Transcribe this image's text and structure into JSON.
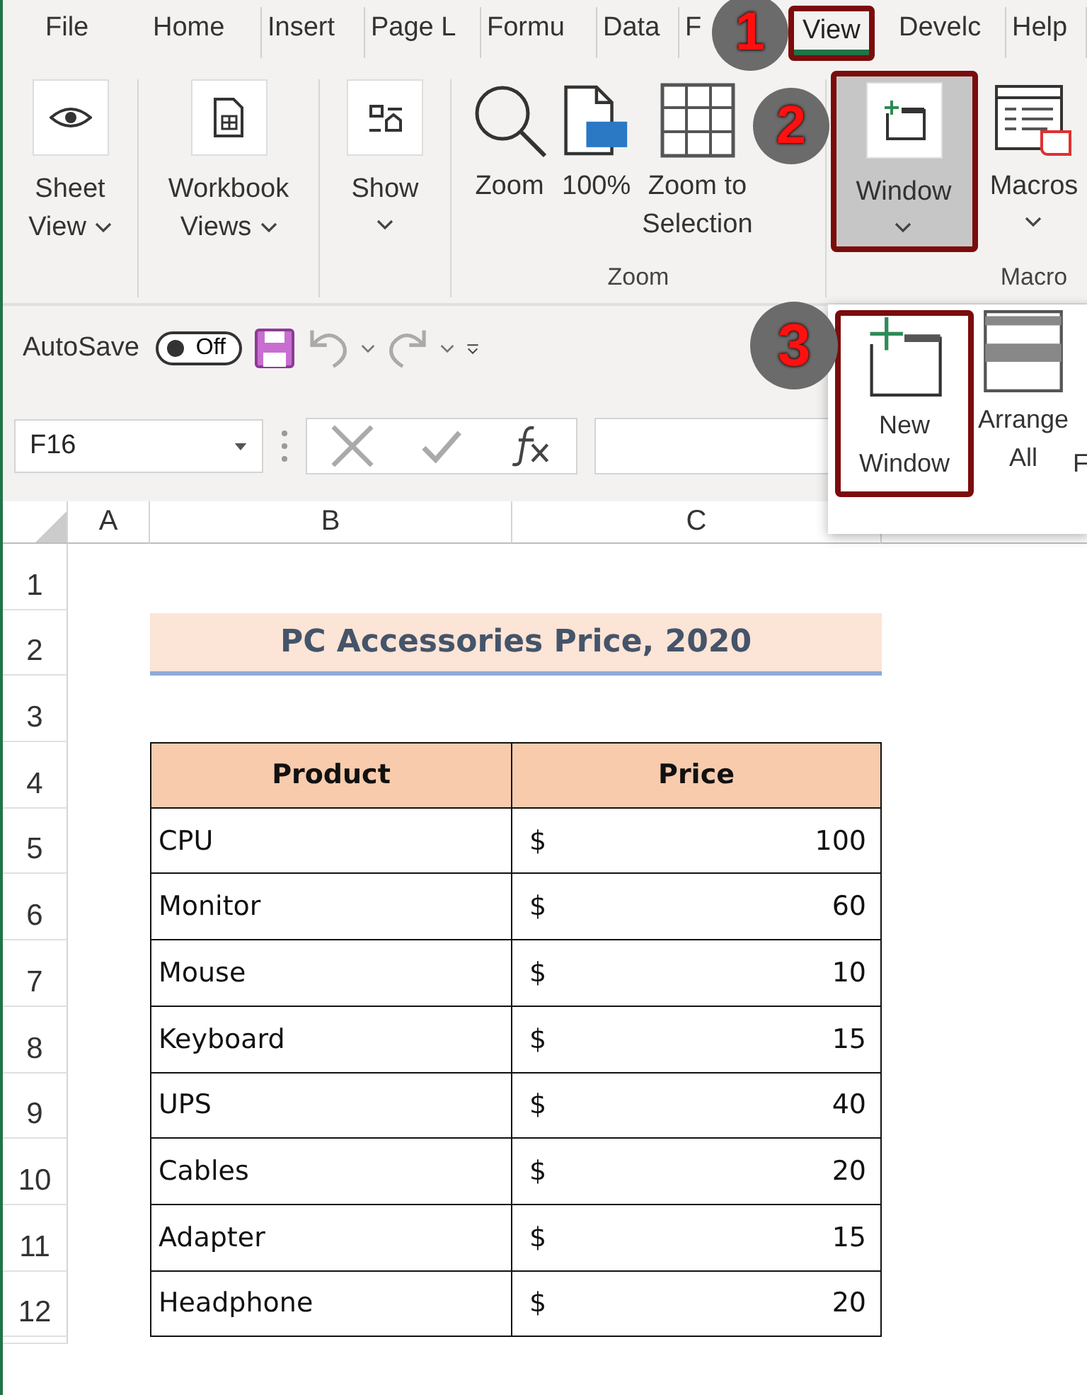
{
  "tabs": [
    {
      "label": "File",
      "selected": false,
      "highlighted": false
    },
    {
      "label": "Home",
      "selected": false,
      "highlighted": false
    },
    {
      "label": "Insert",
      "selected": false,
      "highlighted": false
    },
    {
      "label": "Page L",
      "selected": false,
      "highlighted": false
    },
    {
      "label": "Formu",
      "selected": false,
      "highlighted": false
    },
    {
      "label": "Data",
      "selected": false,
      "highlighted": false
    },
    {
      "label": "F",
      "selected": false,
      "highlighted": false
    },
    {
      "label": "View",
      "selected": true,
      "highlighted": true
    },
    {
      "label": "Develc",
      "selected": false,
      "highlighted": false
    },
    {
      "label": "Help",
      "selected": false,
      "highlighted": false
    }
  ],
  "ribbon": {
    "groups": [
      {
        "buttons": [
          {
            "kind": "eye",
            "label": "Sheet View",
            "menu": true,
            "highlighted": false
          }
        ]
      },
      {
        "buttons": [
          {
            "kind": "workbook",
            "label": "Workbook Views",
            "menu": true,
            "highlighted": false
          }
        ]
      },
      {
        "buttons": [
          {
            "kind": "show",
            "label": "Show",
            "menu": true,
            "highlighted": false
          }
        ]
      },
      {
        "label": "Zoom",
        "buttons": [
          {
            "kind": "magnifier",
            "label": "Zoom",
            "menu": false,
            "highlighted": false
          },
          {
            "kind": "hundred",
            "label": "100%",
            "menu": false,
            "highlighted": false
          },
          {
            "kind": "selection",
            "label": "Zoom to Selection",
            "menu": false,
            "highlighted": false
          }
        ]
      },
      {
        "buttons": [
          {
            "kind": "window",
            "label": "Window",
            "menu": true,
            "highlighted": true
          }
        ]
      },
      {
        "label": "Macro",
        "buttons": [
          {
            "kind": "macros",
            "label": "Macros",
            "menu": true,
            "highlighted": false
          }
        ]
      }
    ]
  },
  "quick_access": {
    "autosave_label": "AutoSave",
    "toggle": {
      "text": "Off",
      "on": false
    }
  },
  "dropdown": {
    "items": [
      {
        "kind": "newwindow",
        "label": "New Window",
        "highlighted": true
      },
      {
        "kind": "arrange",
        "label": "Arrange All",
        "highlighted": false
      },
      {
        "kind": "plain",
        "label": "F",
        "highlighted": false
      }
    ]
  },
  "formula_bar": {
    "name_box": "F16"
  },
  "callouts": [
    {
      "number": "1"
    },
    {
      "number": "2"
    },
    {
      "number": "3"
    }
  ],
  "sheet": {
    "columns": [
      "A",
      "B",
      "C"
    ],
    "row_numbers": [
      "1",
      "2",
      "3",
      "4",
      "5",
      "6",
      "7",
      "8",
      "9",
      "10",
      "11",
      "12"
    ],
    "title": "PC Accessories Price, 2020",
    "table": {
      "columns": [
        "Product",
        "Price"
      ],
      "rows": [
        {
          "product": "CPU",
          "currency": "$",
          "price": "100"
        },
        {
          "product": "Monitor",
          "currency": "$",
          "price": "60"
        },
        {
          "product": "Mouse",
          "currency": "$",
          "price": "10"
        },
        {
          "product": "Keyboard",
          "currency": "$",
          "price": "15"
        },
        {
          "product": "UPS",
          "currency": "$",
          "price": "40"
        },
        {
          "product": "Cables",
          "currency": "$",
          "price": "20"
        },
        {
          "product": "Adapter",
          "currency": "$",
          "price": "15"
        },
        {
          "product": "Headphone",
          "currency": "$",
          "price": "20"
        }
      ]
    }
  }
}
